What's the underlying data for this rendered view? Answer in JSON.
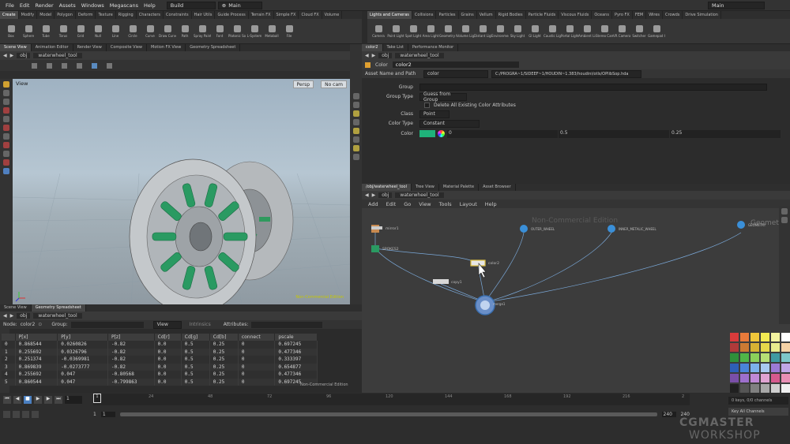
{
  "menu": [
    "File",
    "Edit",
    "Render",
    "Assets",
    "Windows",
    "Megascans",
    "Help"
  ],
  "desktop_left": "Build",
  "desktop_mid": "Main",
  "desktop_right": "Main",
  "shelf_left_tabs": [
    "Create",
    "Modify",
    "Model",
    "Polygon",
    "Deform",
    "Texture",
    "Rigging",
    "Characters",
    "Constraints",
    "Hair Utils",
    "Guide Process",
    "Terrain FX",
    "Simple FX",
    "Cloud FX",
    "Volume"
  ],
  "shelf_left_tools": [
    "Box",
    "Sphere",
    "Tube",
    "Torus",
    "Grid",
    "Null",
    "Line",
    "Circle",
    "Curve",
    "Draw Curve",
    "Path",
    "Spray Paint",
    "Font",
    "Platonic Solids",
    "L-System",
    "Metaball",
    "File"
  ],
  "shelf_right_tabs": [
    "Lights and Cameras",
    "Collisions",
    "Particles",
    "Grains",
    "Vellum",
    "Rigid Bodies",
    "Particle Fluids",
    "Viscous Fluids",
    "Oceans",
    "Pyro FX",
    "FEM",
    "Wires",
    "Crowds",
    "Drive Simulation"
  ],
  "shelf_right_tools": [
    "Camera",
    "Point Light",
    "Spot Light",
    "Area Light",
    "Geometry Light",
    "Volume Light",
    "Distant Light",
    "Environment Light",
    "Sky Light",
    "GI Light",
    "Caustic Light",
    "Portal Light",
    "Ambient Light",
    "Stereo Camera",
    "VR Camera",
    "Switcher",
    "Gamepad Camera"
  ],
  "viewport_tabs": [
    "Scene View",
    "Animation Editor",
    "Render View",
    "Composite View",
    "Motion FX View",
    "Geometry Spreadsheet"
  ],
  "path_obj": "obj",
  "path_node": "waterwheel_tool",
  "viewport_label": "View",
  "persp": "Persp",
  "nocam": "No cam",
  "nce_viewport": "Non-Commercial Edition",
  "sheet_tabs": [
    "Scene View",
    "Geometry Spreadsheet"
  ],
  "sheet_node_label": "Node:",
  "sheet_node": "color2",
  "sheet_group_label": "Group:",
  "sheet_view": "View",
  "sheet_intrinsics": "Intrinsics",
  "sheet_attributes": "Attributes:",
  "sheet_headers": [
    "",
    "P[x]",
    "P[y]",
    "P[z]",
    "Cd[r]",
    "Cd[g]",
    "Cd[b]",
    "connect",
    "pscale"
  ],
  "sheet_rows": [
    [
      "0",
      "0.868544",
      "0.0260826",
      "-0.82",
      "0.0",
      "0.5",
      "0.25",
      "0",
      "0.697245"
    ],
    [
      "1",
      "0.255692",
      "0.0326796",
      "-0.82",
      "0.0",
      "0.5",
      "0.25",
      "0",
      "0.477346"
    ],
    [
      "2",
      "0.251374",
      "-0.0369981",
      "-0.82",
      "0.0",
      "0.5",
      "0.25",
      "0",
      "0.333397"
    ],
    [
      "3",
      "0.869839",
      "-0.0273777",
      "-0.82",
      "0.0",
      "0.5",
      "0.25",
      "0",
      "0.654877"
    ],
    [
      "4",
      "0.255692",
      "0.047",
      "-0.80568",
      "0.0",
      "0.5",
      "0.25",
      "0",
      "0.477346"
    ],
    [
      "5",
      "0.860544",
      "0.047",
      "-0.799863",
      "0.0",
      "0.5",
      "0.25",
      "0",
      "0.697245"
    ]
  ],
  "nce_sheet": "Non-Commercial Edition",
  "parm_tabs": [
    "color2",
    "Take List",
    "Performance Monitor"
  ],
  "parm_type": "Color",
  "parm_name": "color2",
  "asset_label": "Asset Name and Path",
  "asset_name": "color",
  "asset_path": "C:/PROGRA~1/SIDEEF~1/HOUDIN~1.383/houdini/otls/OPlibSop.hda",
  "parms": {
    "group_label": "Group",
    "group_type_label": "Group Type",
    "group_type": "Guess from Group",
    "delete_label": "Delete All Existing Color Attributes",
    "class_label": "Class",
    "class_value": "Point",
    "color_type_label": "Color Type",
    "color_type": "Constant",
    "color_label": "Color",
    "color_r": "0",
    "color_g": "0.5",
    "color_b": "0.25",
    "swatch": "#1fb27a"
  },
  "net_tabs": [
    "/obj/waterwheel_tool",
    "Tree View",
    "Material Palette",
    "Asset Browser"
  ],
  "net_menu": [
    "Add",
    "Edit",
    "Go",
    "View",
    "Tools",
    "Layout",
    "Help"
  ],
  "nce_network": "Non-Commercial Edition",
  "geometry_label": "Geometry",
  "nodes": {
    "mirror": "mirror1",
    "spokes": "SPOKES2",
    "outer": "OUTER_WHEEL",
    "inner": "INNER_METALIC_WHEEL",
    "geo": "GEOMETRY",
    "color": "color2",
    "copy": "copy1",
    "merge": "merge1"
  },
  "timeline_ticks": [
    "24",
    "48",
    "72",
    "96",
    "120",
    "144",
    "168",
    "192",
    "216",
    "2"
  ],
  "frame_current": "1",
  "frame_start": "1",
  "frame_start2": "1",
  "frame_end": "240",
  "frame_end2": "240",
  "keys_info": "0 keys, 0/0 channels",
  "key_all": "Key All Channels",
  "watermark_line1": "CGMASTER",
  "watermark_line2": "WORKSHOP",
  "palette": [
    "#d93b3b",
    "#e87a3a",
    "#f0c63a",
    "#f2ea52",
    "#f5f5a0",
    "#ffffff",
    "#b03a3a",
    "#cc7a33",
    "#d8b233",
    "#e5d84a",
    "#e9ec8e",
    "#f5d2a6",
    "#2f8f3a",
    "#4fb548",
    "#8bd05a",
    "#b6e075",
    "#3f9aa2",
    "#7dc6c9",
    "#2e5fb7",
    "#4a84d9",
    "#7cb1ea",
    "#a8c9f0",
    "#9b7ad6",
    "#c0a6e6",
    "#7a4fa8",
    "#9d6fcc",
    "#c089d6",
    "#e0a3d2",
    "#d65a8e",
    "#e88fb5",
    "#202020",
    "#555555",
    "#808080",
    "#a8a8a8",
    "#cfcfcf",
    "#f0f0f0"
  ],
  "colors": {
    "accent": "#1fb27a",
    "node_blue": "#3a8fd8",
    "node_yellow": "#e0c040"
  }
}
